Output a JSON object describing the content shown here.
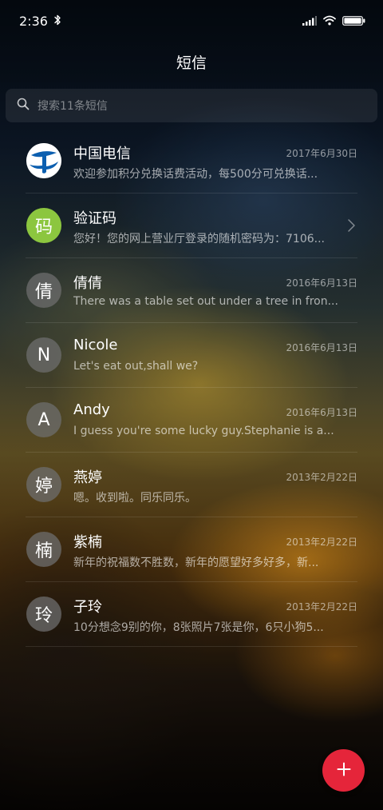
{
  "status_bar": {
    "time": "2:36",
    "icons": [
      "bluetooth-icon",
      "signal-icon",
      "wifi-icon",
      "battery-icon"
    ]
  },
  "header": {
    "title": "短信"
  },
  "search": {
    "placeholder": "搜索11条短信",
    "icon": "search-icon"
  },
  "conversations": [
    {
      "avatar": "telecom-logo",
      "name": "中国电信",
      "date": "2017年6月30日",
      "preview": "欢迎参加积分兑换话费活动，每500分可兑换话..."
    },
    {
      "avatar": "码",
      "name": "验证码",
      "date": "",
      "preview": "您好！您的网上营业厅登录的随机密码为：7106...",
      "accent": "#8cc63f"
    },
    {
      "avatar": "倩",
      "name": "倩倩",
      "date": "2016年6月13日",
      "preview": "There was a table set out under a tree in fron..."
    },
    {
      "avatar": "N",
      "name": "Nicole",
      "date": "2016年6月13日",
      "preview": "Let's eat out,shall we?"
    },
    {
      "avatar": "A",
      "name": "Andy",
      "date": "2016年6月13日",
      "preview": "I guess you're some lucky guy.Stephanie is a..."
    },
    {
      "avatar": "婷",
      "name": "燕婷",
      "date": "2013年2月22日",
      "preview": "嗯。收到啦。同乐同乐。"
    },
    {
      "avatar": "楠",
      "name": "紫楠",
      "date": "2013年2月22日",
      "preview": "新年的祝福数不胜数，新年的愿望好多好多，新..."
    },
    {
      "avatar": "玲",
      "name": "子玲",
      "date": "2013年2月22日",
      "preview": "10分想念9别的你，8张照片7张是你，6只小狗5..."
    }
  ],
  "fab": {
    "icon": "plus-icon",
    "color": "#e5253a"
  }
}
